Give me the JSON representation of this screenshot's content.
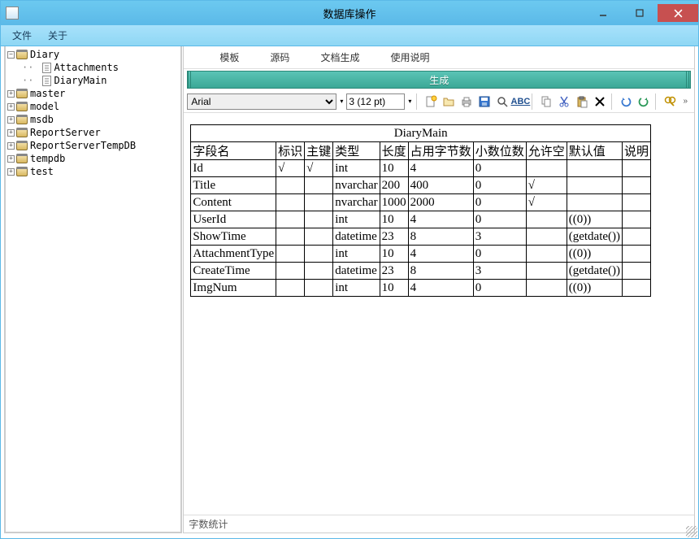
{
  "window": {
    "title": "数据库操作"
  },
  "menu": {
    "file": "文件",
    "about": "关于"
  },
  "tree": [
    {
      "level": 0,
      "expandable": true,
      "expanded": true,
      "icon": "db",
      "label": "Diary"
    },
    {
      "level": 1,
      "expandable": false,
      "icon": "doc",
      "label": "Attachments"
    },
    {
      "level": 1,
      "expandable": false,
      "icon": "doc",
      "label": "DiaryMain"
    },
    {
      "level": 0,
      "expandable": true,
      "expanded": false,
      "icon": "db",
      "label": "master"
    },
    {
      "level": 0,
      "expandable": true,
      "expanded": false,
      "icon": "db",
      "label": "model"
    },
    {
      "level": 0,
      "expandable": true,
      "expanded": false,
      "icon": "db",
      "label": "msdb"
    },
    {
      "level": 0,
      "expandable": true,
      "expanded": false,
      "icon": "db",
      "label": "ReportServer"
    },
    {
      "level": 0,
      "expandable": true,
      "expanded": false,
      "icon": "db",
      "label": "ReportServerTempDB"
    },
    {
      "level": 0,
      "expandable": true,
      "expanded": false,
      "icon": "db",
      "label": "tempdb"
    },
    {
      "level": 0,
      "expandable": true,
      "expanded": false,
      "icon": "db",
      "label": "test"
    }
  ],
  "tabs": {
    "template": "模板",
    "source": "源码",
    "docgen": "文档生成",
    "usage": "使用说明"
  },
  "gen_button": "生成",
  "toolbar": {
    "font": "Arial",
    "size_display": "3 (12 pt)"
  },
  "table": {
    "title": "DiaryMain",
    "header": [
      "字段名",
      "标识",
      "主键",
      "类型",
      "长度",
      "占用字节数",
      "小数位数",
      "允许空",
      "默认值",
      "说明"
    ],
    "rows": [
      {
        "name": "Id",
        "identity": "√",
        "pk": "√",
        "type": "int",
        "len": "10",
        "bytes": "4",
        "dec": "0",
        "null": "",
        "def": "",
        "desc": ""
      },
      {
        "name": "Title",
        "identity": "",
        "pk": "",
        "type": "nvarchar",
        "len": "200",
        "bytes": "400",
        "dec": "0",
        "null": "√",
        "def": "",
        "desc": ""
      },
      {
        "name": "Content",
        "identity": "",
        "pk": "",
        "type": "nvarchar",
        "len": "1000",
        "bytes": "2000",
        "dec": "0",
        "null": "√",
        "def": "",
        "desc": ""
      },
      {
        "name": "UserId",
        "identity": "",
        "pk": "",
        "type": "int",
        "len": "10",
        "bytes": "4",
        "dec": "0",
        "null": "",
        "def": "((0))",
        "desc": ""
      },
      {
        "name": "ShowTime",
        "identity": "",
        "pk": "",
        "type": "datetime",
        "len": "23",
        "bytes": "8",
        "dec": "3",
        "null": "",
        "def": "(getdate())",
        "desc": ""
      },
      {
        "name": "AttachmentType",
        "identity": "",
        "pk": "",
        "type": "int",
        "len": "10",
        "bytes": "4",
        "dec": "0",
        "null": "",
        "def": "((0))",
        "desc": ""
      },
      {
        "name": "CreateTime",
        "identity": "",
        "pk": "",
        "type": "datetime",
        "len": "23",
        "bytes": "8",
        "dec": "3",
        "null": "",
        "def": "(getdate())",
        "desc": ""
      },
      {
        "name": "ImgNum",
        "identity": "",
        "pk": "",
        "type": "int",
        "len": "10",
        "bytes": "4",
        "dec": "0",
        "null": "",
        "def": "((0))",
        "desc": ""
      }
    ]
  },
  "statusbar": {
    "wordcount": "字数统计"
  }
}
